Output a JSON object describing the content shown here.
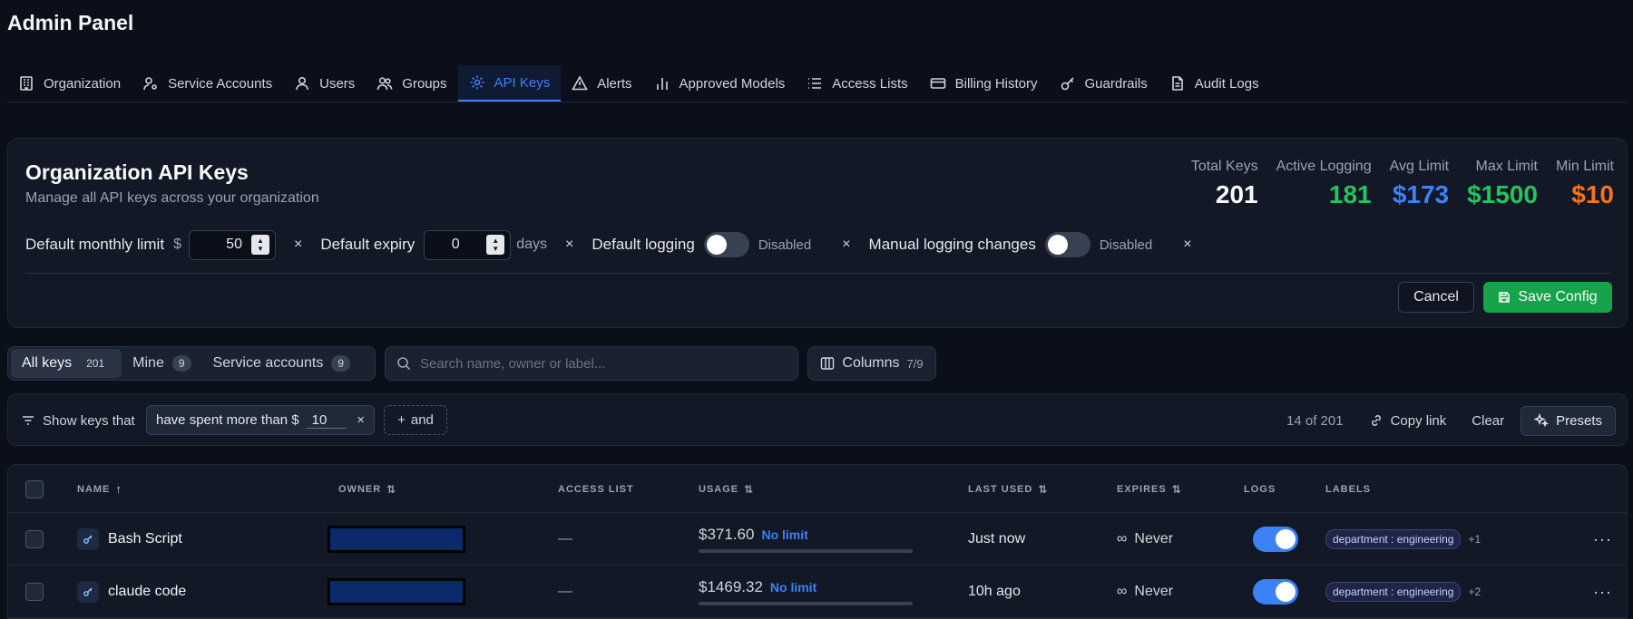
{
  "app": {
    "title": "Admin Panel"
  },
  "tabs": [
    {
      "label": "Organization",
      "icon": "building-icon"
    },
    {
      "label": "Service Accounts",
      "icon": "user-gear-icon"
    },
    {
      "label": "Users",
      "icon": "user-icon"
    },
    {
      "label": "Groups",
      "icon": "users-icon"
    },
    {
      "label": "API Keys",
      "icon": "gear-icon",
      "active": true
    },
    {
      "label": "Alerts",
      "icon": "warning-icon"
    },
    {
      "label": "Approved Models",
      "icon": "bar-chart-icon"
    },
    {
      "label": "Access Lists",
      "icon": "list-icon"
    },
    {
      "label": "Billing History",
      "icon": "credit-card-icon"
    },
    {
      "label": "Guardrails",
      "icon": "key-icon"
    },
    {
      "label": "Audit Logs",
      "icon": "document-icon"
    }
  ],
  "config": {
    "title": "Organization API Keys",
    "subtitle": "Manage all API keys across your organization",
    "stats": [
      {
        "label": "Total Keys",
        "value": "201",
        "color": "#f9fafb"
      },
      {
        "label": "Active Logging",
        "value": "181",
        "color": "#22c55e"
      },
      {
        "label": "Avg Limit",
        "value": "$173",
        "color": "#3b82f6"
      },
      {
        "label": "Max Limit",
        "value": "$1500",
        "color": "#22c55e"
      },
      {
        "label": "Min Limit",
        "value": "$10",
        "color": "#f97316"
      }
    ],
    "monthly_limit_label": "Default monthly limit",
    "currency_symbol": "$",
    "monthly_limit_value": "50",
    "expiry_label": "Default expiry",
    "expiry_value": "0",
    "expiry_unit": "days",
    "logging_label": "Default logging",
    "logging_state": "Disabled",
    "logging_on": false,
    "manual_label": "Manual logging changes",
    "manual_state": "Disabled",
    "manual_on": false,
    "clear_symbol": "×",
    "cancel_label": "Cancel",
    "save_label": "Save Config"
  },
  "filters": {
    "segments": [
      {
        "label": "All keys",
        "count": "201",
        "active": true
      },
      {
        "label": "Mine",
        "count": "9"
      },
      {
        "label": "Service accounts",
        "count": "9"
      }
    ],
    "search_placeholder": "Search name, owner or label...",
    "columns_label": "Columns",
    "columns_count": "7/9"
  },
  "query": {
    "show_label": "Show keys that",
    "condition_text": "have spent more than $",
    "condition_value": "10",
    "and_label": "and",
    "result_count": "14 of 201",
    "copy_link_label": "Copy link",
    "clear_label": "Clear",
    "presets_label": "Presets"
  },
  "table": {
    "headers": {
      "name": "NAME",
      "owner": "OWNER",
      "access_list": "ACCESS LIST",
      "usage": "USAGE",
      "last_used": "LAST USED",
      "expires": "EXPIRES",
      "logs": "LOGS",
      "labels": "LABELS"
    },
    "rows": [
      {
        "name": "Bash Script",
        "access_list": "—",
        "usage": "$371.60",
        "limit": "No limit",
        "last_used": "Just now",
        "expires": "Never",
        "logs_on": true,
        "label": "department : engineering",
        "label_more": "+1"
      },
      {
        "name": "claude code",
        "access_list": "—",
        "usage": "$1469.32",
        "limit": "No limit",
        "last_used": "10h ago",
        "expires": "Never",
        "logs_on": true,
        "label": "department : engineering",
        "label_more": "+2"
      }
    ]
  },
  "colors": {
    "accent": "#3b82f6",
    "save": "#16a34a",
    "background": "#0b0f19"
  }
}
